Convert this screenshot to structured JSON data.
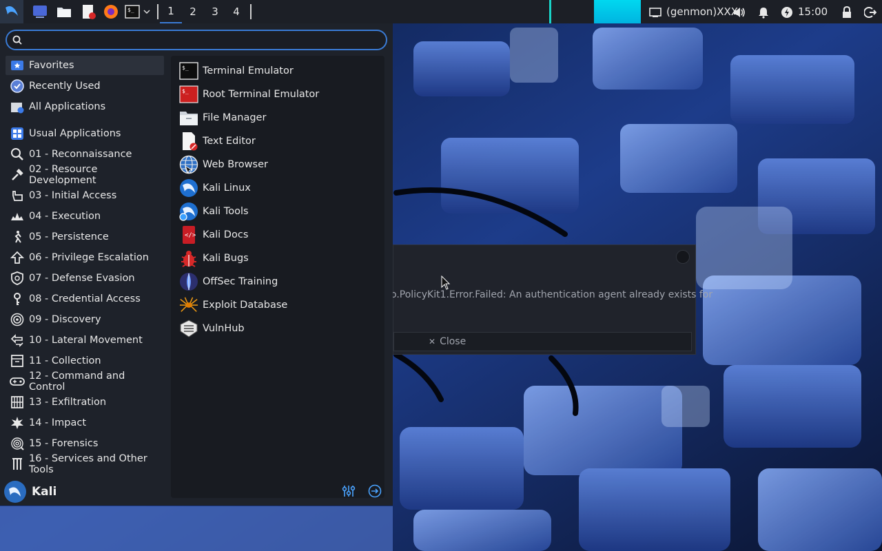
{
  "panel": {
    "workspaces": [
      "1",
      "2",
      "3",
      "4"
    ],
    "active_workspace": "1",
    "genmon": "(genmon)XXX",
    "clock": "15:00"
  },
  "menu": {
    "search": {
      "value": "",
      "placeholder": ""
    },
    "categories": [
      {
        "label": "Favorites",
        "icon": "star-icon"
      },
      {
        "label": "Recently Used",
        "icon": "recent-icon"
      },
      {
        "label": "All Applications",
        "icon": "all-apps-icon"
      },
      {
        "label": "Usual Applications",
        "icon": "grid-icon"
      },
      {
        "label": "01 - Reconnaissance",
        "icon": "magnifier-icon"
      },
      {
        "label": "02 - Resource Development",
        "icon": "hammer-icon"
      },
      {
        "label": "03 - Initial Access",
        "icon": "hand-icon"
      },
      {
        "label": "04 - Execution",
        "icon": "explosion-icon"
      },
      {
        "label": "05 - Persistence",
        "icon": "runner-icon"
      },
      {
        "label": "06 - Privilege Escalation",
        "icon": "arrow-up-icon"
      },
      {
        "label": "07 - Defense Evasion",
        "icon": "shield-icon"
      },
      {
        "label": "08 - Credential Access",
        "icon": "key-icon"
      },
      {
        "label": "09 - Discovery",
        "icon": "radar-icon"
      },
      {
        "label": "10 - Lateral Movement",
        "icon": "lateral-arrows-icon"
      },
      {
        "label": "11 - Collection",
        "icon": "box-icon"
      },
      {
        "label": "12 - Command and Control",
        "icon": "gamepad-icon"
      },
      {
        "label": "13 - Exfiltration",
        "icon": "data-out-icon"
      },
      {
        "label": "14 - Impact",
        "icon": "impact-icon"
      },
      {
        "label": "15 - Forensics",
        "icon": "fingerprint-icon"
      },
      {
        "label": "16 - Services and Other Tools",
        "icon": "tools-icon"
      }
    ],
    "selected_category": "Favorites",
    "apps": [
      {
        "label": "Terminal Emulator",
        "icon": "terminal-icon"
      },
      {
        "label": "Root Terminal Emulator",
        "icon": "root-terminal-icon"
      },
      {
        "label": "File Manager",
        "icon": "folder-icon"
      },
      {
        "label": "Text Editor",
        "icon": "text-editor-icon"
      },
      {
        "label": "Web Browser",
        "icon": "globe-icon"
      },
      {
        "label": "Kali Linux",
        "icon": "kali-dragon-icon"
      },
      {
        "label": "Kali Tools",
        "icon": "kali-tools-icon"
      },
      {
        "label": "Kali Docs",
        "icon": "kali-docs-icon"
      },
      {
        "label": "Kali Bugs",
        "icon": "bug-icon"
      },
      {
        "label": "OffSec Training",
        "icon": "offsec-icon"
      },
      {
        "label": "Exploit Database",
        "icon": "spider-icon"
      },
      {
        "label": "VulnHub",
        "icon": "vulnhub-icon"
      }
    ],
    "user": "Kali"
  },
  "dialog": {
    "message": "o.PolicyKit1.Error.Failed: An authentication agent already exists for",
    "close_label": "Close"
  },
  "colors": {
    "accent": "#3a7bd5",
    "panel_bg": "#1c1f26",
    "menu_bg": "#1e222a"
  }
}
